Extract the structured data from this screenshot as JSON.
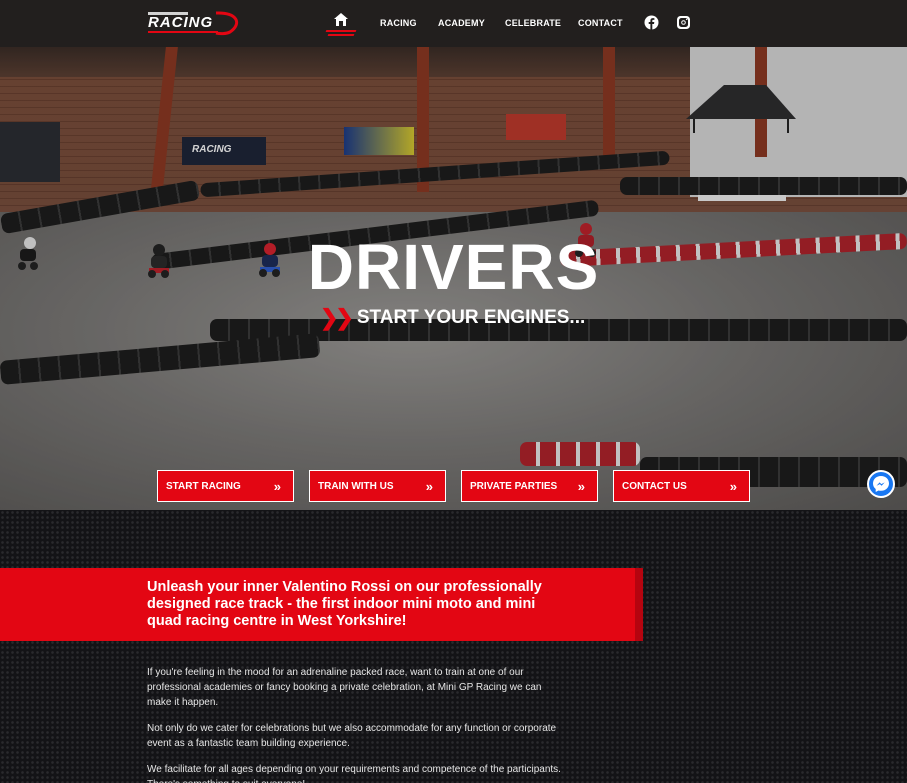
{
  "nav": {
    "logo_text": "RACING",
    "home_icon": "home-icon",
    "links": [
      "RACING",
      "ACADEMY",
      "CELEBRATE",
      "CONTACT"
    ],
    "social_icons": [
      "facebook-icon",
      "instagram-icon"
    ]
  },
  "hero": {
    "title": "DRIVERS",
    "subtitle": "START YOUR ENGINES...",
    "buttons": [
      {
        "label": "START RACING"
      },
      {
        "label": "TRAIN WITH US"
      },
      {
        "label": "PRIVATE PARTIES"
      },
      {
        "label": "CONTACT US"
      }
    ],
    "scene_banners": [
      "RACING",
      "racing"
    ]
  },
  "messenger_icon": "messenger-icon",
  "intro": {
    "headline": "Unleash your inner Valentino Rossi on our professionally designed race track - the first indoor mini moto and mini quad racing centre in West Yorkshire!",
    "paragraphs": [
      "If you're feeling in the mood for an adrenaline packed race, want to train at one of our professional academies or fancy booking a private celebration, at Mini GP Racing we can make it happen.",
      "Not only do we cater for celebrations but we also accommodate for any function or corporate event as a fantastic team building experience.",
      "We facilitate for all ages depending on your requirements and competence of the participants. There's something to suit everyone!"
    ]
  },
  "colors": {
    "accent": "#e30613",
    "nav_bg": "#221f1e",
    "dark_bg": "#131316"
  }
}
